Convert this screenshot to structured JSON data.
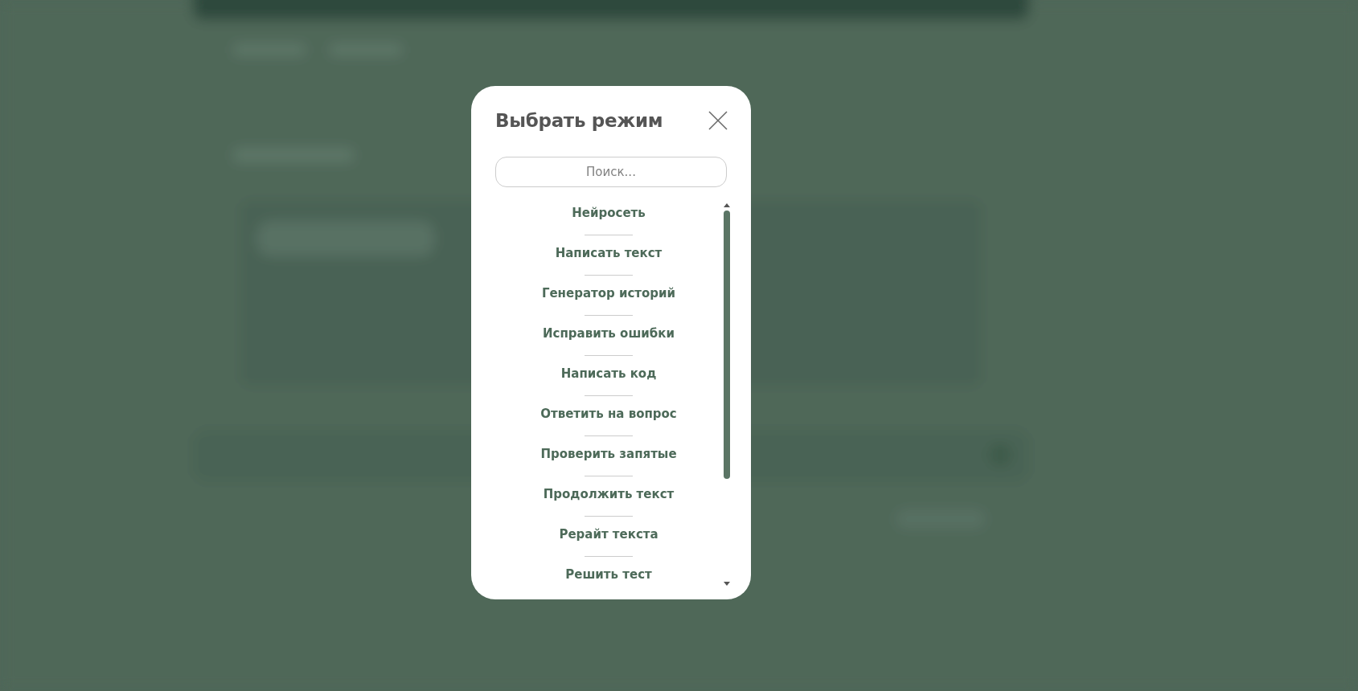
{
  "dialog": {
    "title": "Выбрать режим",
    "search": {
      "placeholder": "Поиск..."
    },
    "modes": [
      {
        "label": "Нейросеть",
        "selected": false
      },
      {
        "label": "Написать текст",
        "selected": false
      },
      {
        "label": "Генератор историй",
        "selected": false
      },
      {
        "label": "Исправить ошибки",
        "selected": false
      },
      {
        "label": "Написать код",
        "selected": false
      },
      {
        "label": "Ответить на вопрос",
        "selected": false
      },
      {
        "label": "Проверить запятые",
        "selected": false
      },
      {
        "label": "Продолжить текст",
        "selected": false
      },
      {
        "label": "Рерайт текста",
        "selected": false
      },
      {
        "label": "Решить тест",
        "selected": false
      }
    ]
  }
}
